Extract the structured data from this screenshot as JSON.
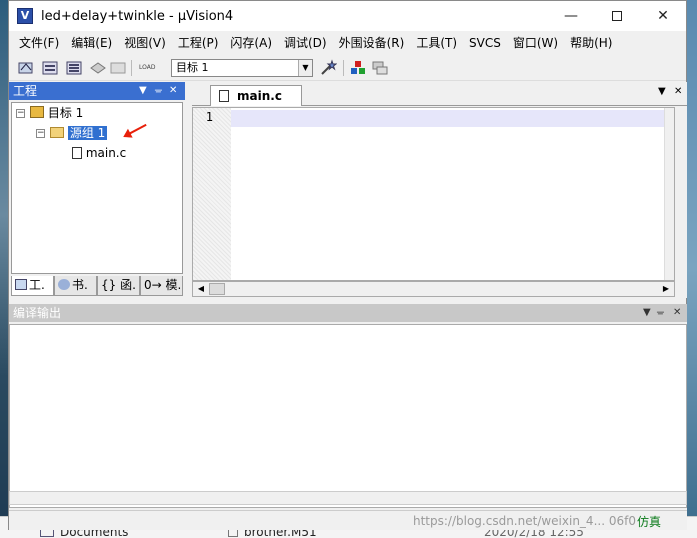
{
  "window": {
    "title": "led+delay+twinkle  - μVision4",
    "minimize": "—",
    "maximize": "",
    "close": "✕"
  },
  "menu": [
    "文件(F)",
    "编辑(E)",
    "视图(V)",
    "工程(P)",
    "闪存(A)",
    "调试(D)",
    "外围设备(R)",
    "工具(T)",
    "SVCS",
    "窗口(W)",
    "帮助(H)"
  ],
  "toolbar": {
    "target": "目标 1",
    "load_label": "LOAD"
  },
  "project_panel": {
    "title": "工程",
    "tree": {
      "target": "目标 1",
      "group": "源组 1",
      "file": "main.c"
    },
    "tabs": [
      "工.",
      "书.",
      "{} 函.",
      "0→ 模."
    ]
  },
  "editor": {
    "tab": "main.c",
    "line_number": "1"
  },
  "output_panel": {
    "title": "编译输出"
  },
  "status": {
    "mode": "仿真",
    "watermark": "https://blog.csdn.net/weixin_4... 06f0"
  },
  "desktop": {
    "documents": "Documents",
    "file": "brother.M51",
    "date": "2020/2/18 12:55"
  },
  "colors": {
    "panel_header": "#3a6fd0",
    "selection": "#3070d0",
    "current_line": "#e6e6fa",
    "annotation_arrow": "#e8200a"
  }
}
